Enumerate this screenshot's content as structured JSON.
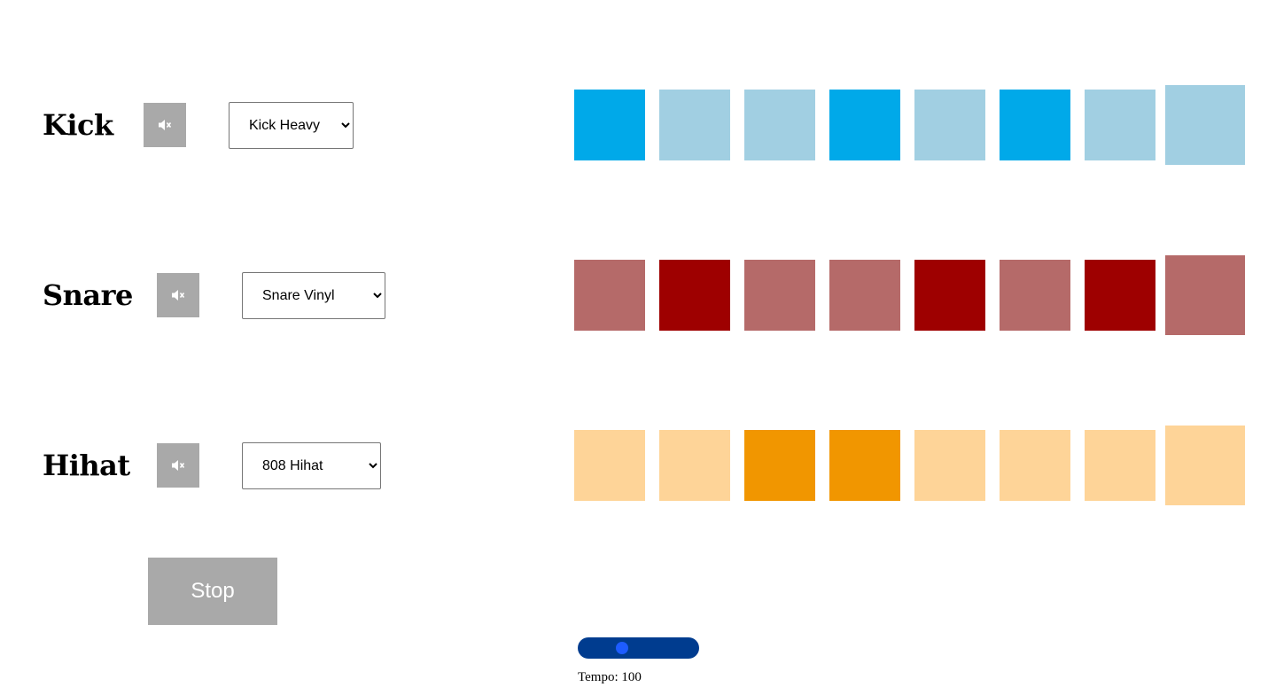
{
  "tracks": [
    {
      "name": "Kick",
      "mute_icon": "speaker-muted-icon",
      "sample": "Kick Heavy",
      "color_on": "#00a9e9",
      "color_off": "#a1cfe2",
      "steps": [
        true,
        false,
        false,
        true,
        false,
        true,
        false,
        false
      ]
    },
    {
      "name": "Snare",
      "mute_icon": "speaker-muted-icon",
      "sample": "Snare Vinyl",
      "color_on": "#9e0000",
      "color_off": "#b56a69",
      "steps": [
        false,
        true,
        false,
        false,
        true,
        false,
        true,
        false
      ]
    },
    {
      "name": "Hihat",
      "mute_icon": "speaker-muted-icon",
      "sample": "808 Hihat",
      "color_on": "#f19600",
      "color_off": "#fed498",
      "steps": [
        false,
        false,
        true,
        true,
        false,
        false,
        false,
        false
      ]
    }
  ],
  "current_step": 7,
  "transport": {
    "stop_label": "Stop"
  },
  "tempo": {
    "label": "Tempo: 100",
    "value_fraction": 0.25,
    "track_color": "#003c8f",
    "thumb_color": "#1d5cff"
  }
}
